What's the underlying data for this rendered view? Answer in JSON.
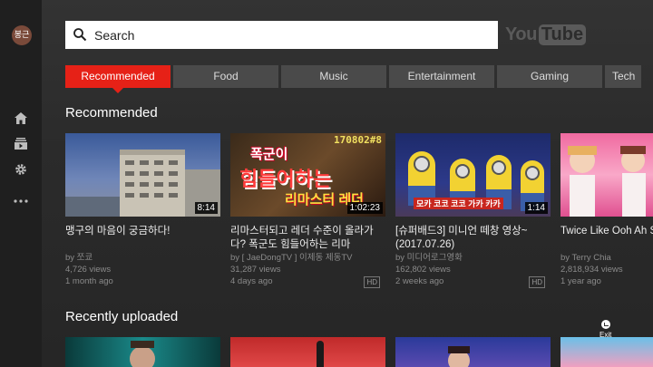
{
  "sidebar": {
    "avatar_text": "봉근",
    "icons": [
      "home-icon",
      "subscriptions-icon",
      "settings-icon",
      "more-icon"
    ]
  },
  "search": {
    "label": "Search"
  },
  "logo": {
    "you": "You",
    "tube": "Tube"
  },
  "tabs": [
    "Recommended",
    "Food",
    "Music",
    "Entertainment",
    "Gaming",
    "Tech"
  ],
  "recommended": {
    "title": "Recommended",
    "videos": [
      {
        "title": "맹구의 마음이 궁금하다!",
        "channel": "by 쪼쿄",
        "views": "4,726 views",
        "age": "1 month ago",
        "duration": "8:14",
        "hd": ""
      },
      {
        "title": "리마스터되고 레더 수준이 올라가다? 폭군도 힘들어하는 리마",
        "channel": "by [ JaeDongTV ] 이제동 제동TV",
        "views": "31,287 views",
        "age": "4 days ago",
        "duration": "1:02:23",
        "hd": "HD"
      },
      {
        "title": "[슈퍼배드3] 미니언 떼창 영상~ (2017.07.26)",
        "channel": "by 미디어로그영화",
        "views": "162,802 views",
        "age": "2 weeks ago",
        "duration": "1:14",
        "hd": "HD"
      },
      {
        "title": "Twice Like Ooh Ah SBS KBO Golden G",
        "channel": "by Terry Chia",
        "views": "2,818,934 views",
        "age": "1 year ago",
        "duration": "",
        "hd": ""
      }
    ],
    "thumb2_text": {
      "top": "170802#8",
      "line1": "폭군이",
      "line2": "힘들어하는",
      "line3": "리마스터 레더"
    },
    "thumb3_text": "모카 코코 코코 가카 카카"
  },
  "recent": {
    "title": "Recently uploaded"
  },
  "exit_label": "Exit"
}
